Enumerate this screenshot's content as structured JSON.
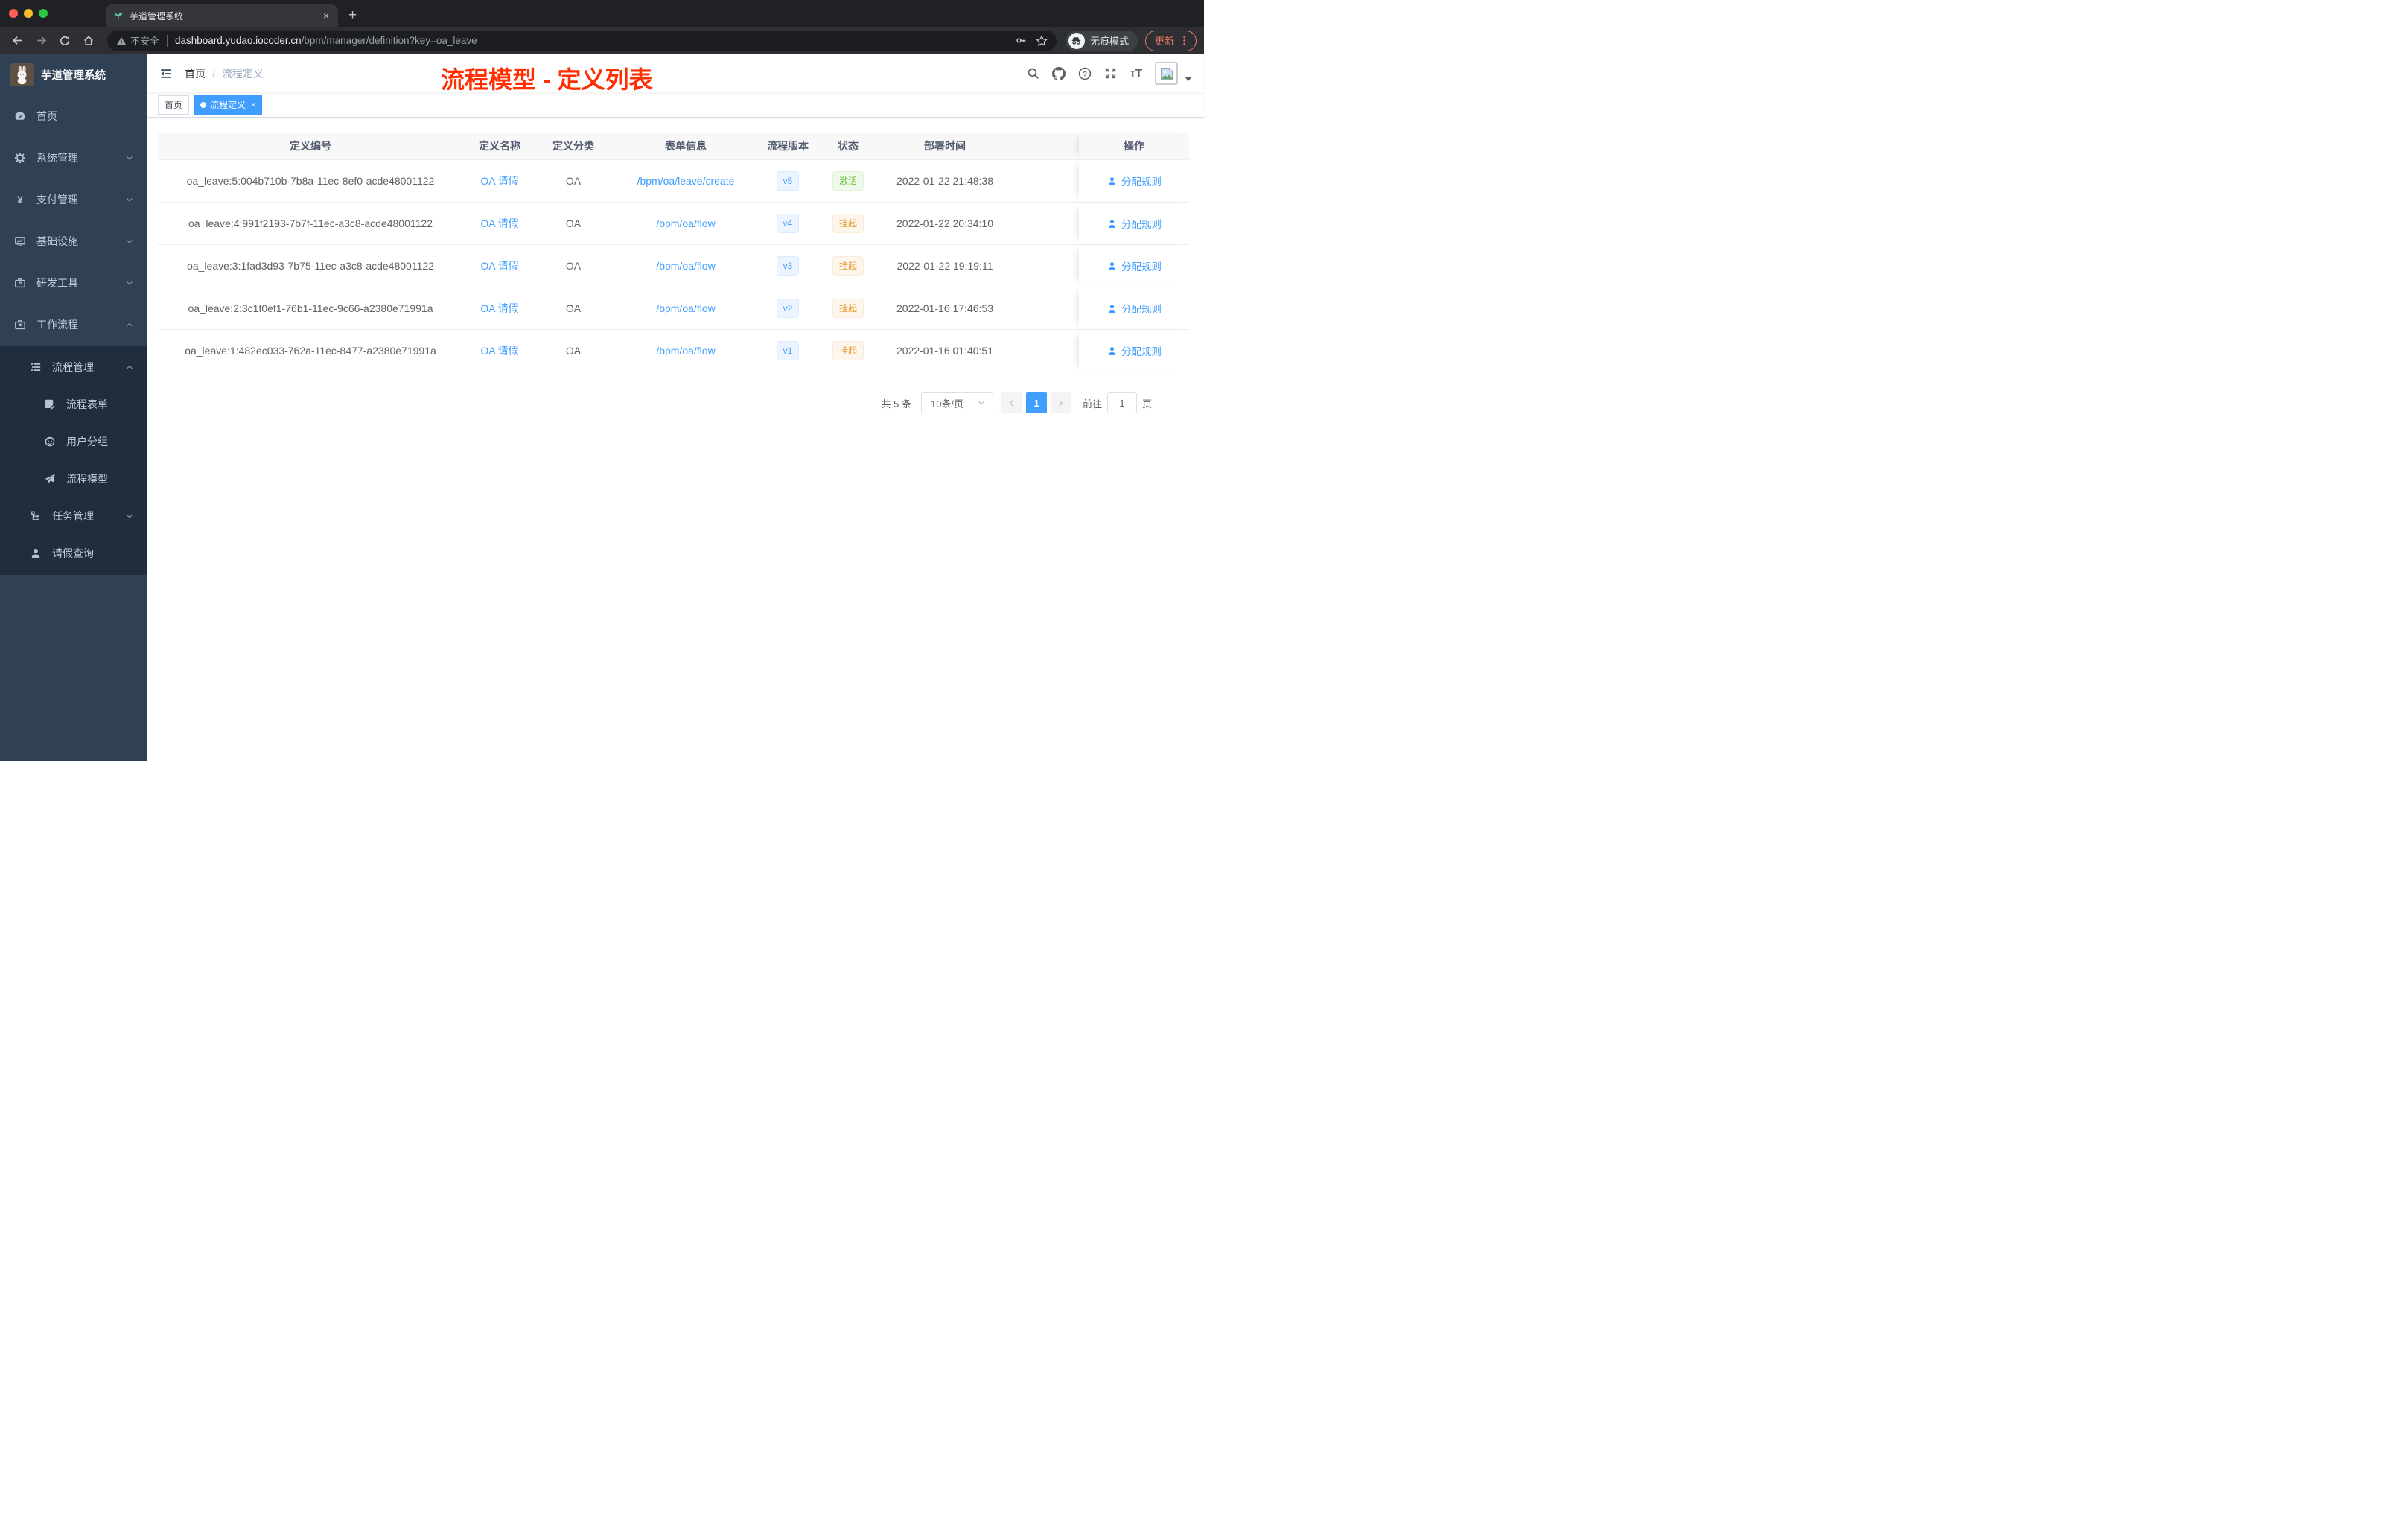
{
  "browser": {
    "tab_title": "芋道管理系统",
    "tab_close": "×",
    "new_tab": "+",
    "url": {
      "warning_label": "不安全",
      "host": "dashboard.yudao.iocoder.cn",
      "path": "/bpm/manager/definition?key=oa_leave"
    },
    "incognito_label": "无痕模式",
    "update_label": "更新"
  },
  "sidebar": {
    "logo_title": "芋道管理系统",
    "menu": [
      {
        "key": "home",
        "label": "首页",
        "icon": "dashboard-icon",
        "level": 1,
        "arrow": "none"
      },
      {
        "key": "system-mgmt",
        "label": "系统管理",
        "icon": "gear-icon",
        "level": 1,
        "arrow": "down"
      },
      {
        "key": "payment-mgmt",
        "label": "支付管理",
        "icon": "yen-icon",
        "level": 1,
        "arrow": "down"
      },
      {
        "key": "infrastructure",
        "label": "基础设施",
        "icon": "monitor-icon",
        "level": 1,
        "arrow": "down"
      },
      {
        "key": "dev-tools",
        "label": "研发工具",
        "icon": "briefcase-icon",
        "level": 1,
        "arrow": "down"
      },
      {
        "key": "workflow",
        "label": "工作流程",
        "icon": "briefcase-icon",
        "level": 1,
        "arrow": "up"
      }
    ],
    "submenu": [
      {
        "key": "process-mgmt",
        "label": "流程管理",
        "icon": "list-icon",
        "level": 2,
        "arrow": "up"
      },
      {
        "key": "process-form",
        "label": "流程表单",
        "icon": "form-icon",
        "level": 3,
        "arrow": "none"
      },
      {
        "key": "user-group",
        "label": "用户分组",
        "icon": "group-icon",
        "level": 3,
        "arrow": "none"
      },
      {
        "key": "process-model",
        "label": "流程模型",
        "icon": "plane-icon",
        "level": 3,
        "arrow": "none"
      },
      {
        "key": "task-mgmt",
        "label": "任务管理",
        "icon": "tree-icon",
        "level": 2,
        "arrow": "down"
      },
      {
        "key": "leave-query",
        "label": "请假查询",
        "icon": "user-icon",
        "level": 2,
        "arrow": "none"
      }
    ]
  },
  "navbar": {
    "breadcrumb_home": "首页",
    "breadcrumb_sep": "/",
    "breadcrumb_current": "流程定义",
    "annotation": "流程模型 - 定义列表"
  },
  "tags": {
    "home": "首页",
    "current": "流程定义",
    "current_close": "×"
  },
  "table": {
    "columns": [
      "定义编号",
      "定义名称",
      "定义分类",
      "表单信息",
      "流程版本",
      "状态",
      "部署时间",
      "操作"
    ],
    "rows": [
      {
        "id": "oa_leave:5:004b710b-7b8a-11ec-8ef0-acde48001122",
        "name": "OA 请假",
        "category": "OA",
        "form": "/bpm/oa/leave/create",
        "version": "v5",
        "status": "激活",
        "status_type": "success",
        "deploy_time": "2022-01-22 21:48:38",
        "action": "分配规则"
      },
      {
        "id": "oa_leave:4:991f2193-7b7f-11ec-a3c8-acde48001122",
        "name": "OA 请假",
        "category": "OA",
        "form": "/bpm/oa/flow",
        "version": "v4",
        "status": "挂起",
        "status_type": "warning",
        "deploy_time": "2022-01-22 20:34:10",
        "action": "分配规则"
      },
      {
        "id": "oa_leave:3:1fad3d93-7b75-11ec-a3c8-acde48001122",
        "name": "OA 请假",
        "category": "OA",
        "form": "/bpm/oa/flow",
        "version": "v3",
        "status": "挂起",
        "status_type": "warning",
        "deploy_time": "2022-01-22 19:19:11",
        "action": "分配规则"
      },
      {
        "id": "oa_leave:2:3c1f0ef1-76b1-11ec-9c66-a2380e71991a",
        "name": "OA 请假",
        "category": "OA",
        "form": "/bpm/oa/flow",
        "version": "v2",
        "status": "挂起",
        "status_type": "warning",
        "deploy_time": "2022-01-16 17:46:53",
        "action": "分配规则"
      },
      {
        "id": "oa_leave:1:482ec033-762a-11ec-8477-a2380e71991a",
        "name": "OA 请假",
        "category": "OA",
        "form": "/bpm/oa/flow",
        "version": "v1",
        "status": "挂起",
        "status_type": "warning",
        "deploy_time": "2022-01-16 01:40:51",
        "action": "分配规则"
      }
    ]
  },
  "pagination": {
    "total_label": "共 5 条",
    "page_size": "10条/页",
    "current_page": "1",
    "jumper_prefix": "前往",
    "jumper_value": "1",
    "jumper_suffix": "页"
  },
  "colors": {
    "accent": "#409eff",
    "success": "#67c23a",
    "warning": "#e6a23c",
    "annotation_red": "#ff2d00",
    "sidebar_bg": "#304156",
    "submenu_bg": "#1f2d3d"
  }
}
